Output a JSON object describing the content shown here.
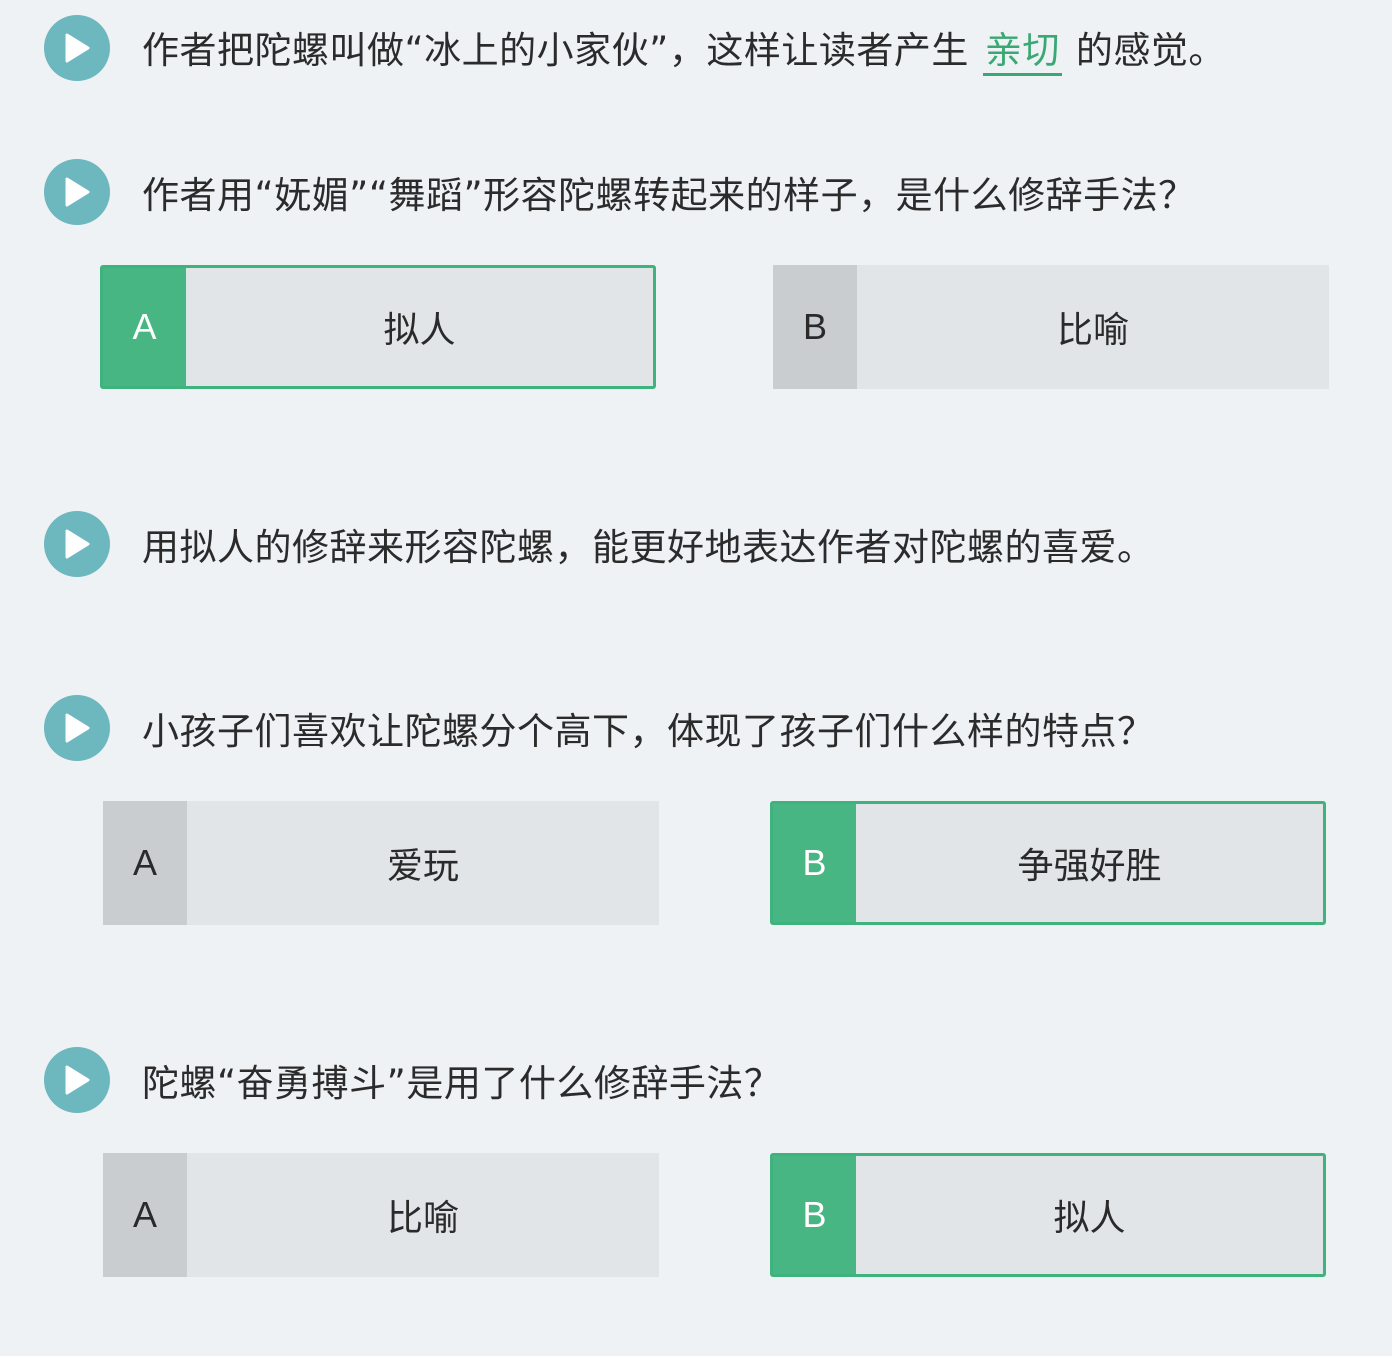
{
  "colors": {
    "background": "#eef2f4",
    "play_icon": "#6db7bf",
    "correct_green": "#47b683",
    "option_bg": "#e1e5e8",
    "letter_bg": "#c9cdd0"
  },
  "items": [
    {
      "icon": "play-icon",
      "text_before": "作者把陀螺叫做“冰上的小家伙”，这样让读者产生",
      "blank": "亲切",
      "text_after": "的感觉。"
    },
    {
      "icon": "play-icon",
      "question": "作者用“妩媚”“舞蹈”形容陀螺转起来的样子，是什么修辞手法？",
      "options": [
        {
          "letter": "A",
          "label": "拟人",
          "selected": true
        },
        {
          "letter": "B",
          "label": "比喻",
          "selected": false
        }
      ]
    },
    {
      "icon": "play-icon",
      "statement": "用拟人的修辞来形容陀螺，能更好地表达作者对陀螺的喜爱。"
    },
    {
      "icon": "play-icon",
      "question": "小孩子们喜欢让陀螺分个高下，体现了孩子们什么样的特点？",
      "options": [
        {
          "letter": "A",
          "label": "爱玩",
          "selected": false
        },
        {
          "letter": "B",
          "label": "争强好胜",
          "selected": true
        }
      ]
    },
    {
      "icon": "play-icon",
      "question": "陀螺“奋勇搏斗”是用了什么修辞手法？",
      "options": [
        {
          "letter": "A",
          "label": "比喻",
          "selected": false
        },
        {
          "letter": "B",
          "label": "拟人",
          "selected": true
        }
      ]
    }
  ]
}
